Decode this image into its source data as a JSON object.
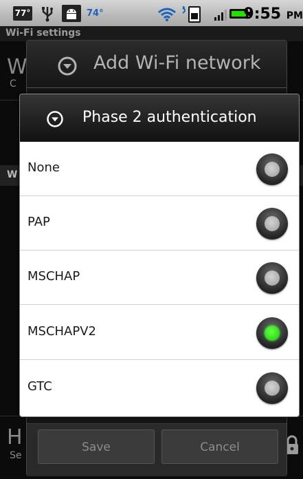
{
  "status_bar": {
    "temp_badge": "77°",
    "temp_text": "74°",
    "time": "9:55",
    "ampm": "PM"
  },
  "background": {
    "title": "Wi-Fi settings",
    "row1_letter": "W",
    "row1_sub": "C",
    "row2_letter": "W",
    "row3_letter": "H",
    "row3_sub": "Se"
  },
  "add_dialog": {
    "title": "Add Wi-Fi network",
    "save_label": "Save",
    "cancel_label": "Cancel"
  },
  "phase_dialog": {
    "title": "Phase 2 authentication",
    "options": [
      {
        "label": "None",
        "selected": false
      },
      {
        "label": "PAP",
        "selected": false
      },
      {
        "label": "MSCHAP",
        "selected": false
      },
      {
        "label": "MSCHAPV2",
        "selected": true
      },
      {
        "label": "GTC",
        "selected": false
      }
    ],
    "selected_color": "#12cc00"
  },
  "icons": [
    "usb-icon",
    "android-icon",
    "wifi-icon",
    "sim-icon",
    "signal-icon",
    "battery-icon",
    "chevron-down-icon",
    "lock-icon"
  ]
}
